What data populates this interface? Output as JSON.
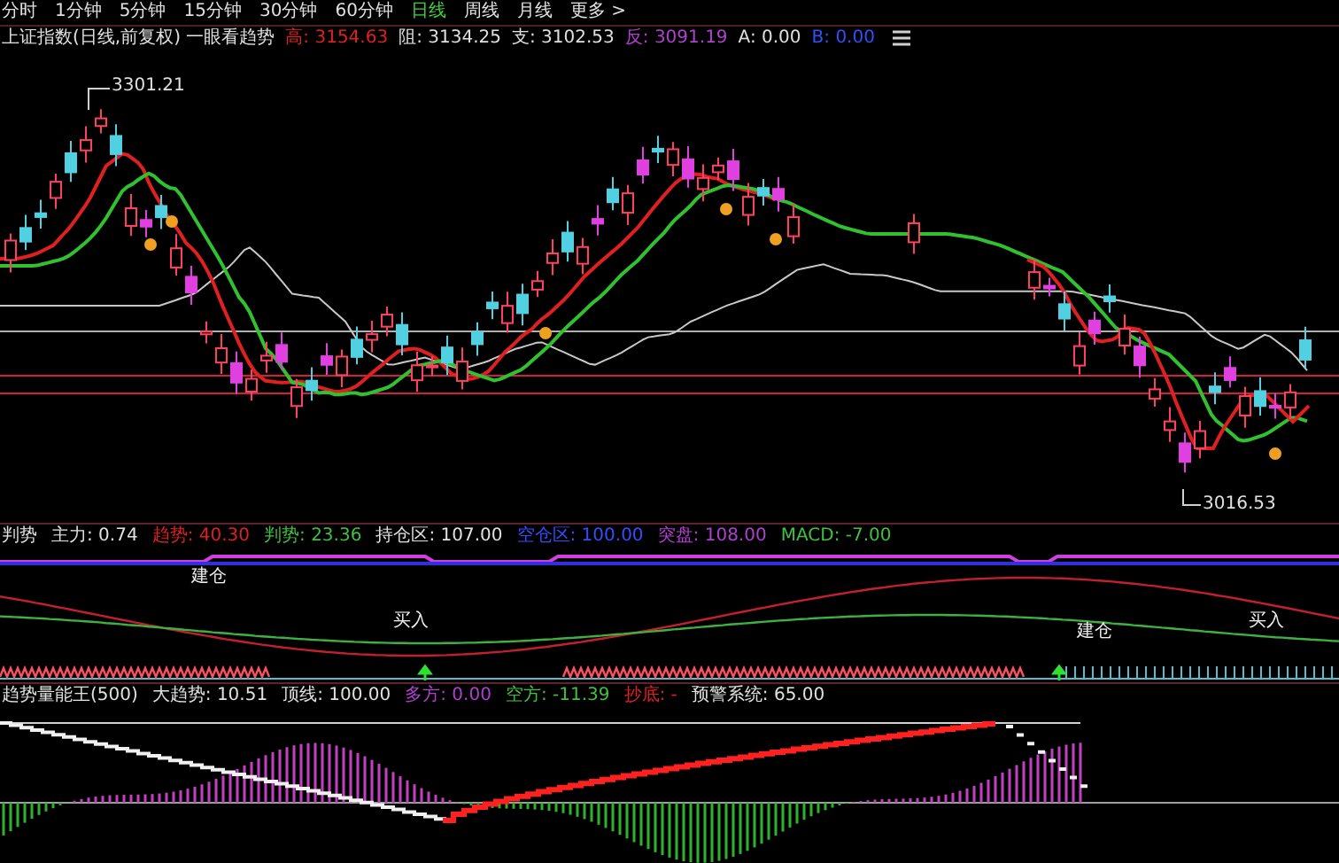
{
  "tabs": [
    {
      "label": "分时",
      "selected": false
    },
    {
      "label": "1分钟",
      "selected": false
    },
    {
      "label": "5分钟",
      "selected": false
    },
    {
      "label": "15分钟",
      "selected": false
    },
    {
      "label": "30分钟",
      "selected": false
    },
    {
      "label": "60分钟",
      "selected": false
    },
    {
      "label": "日线",
      "selected": true
    },
    {
      "label": "周线",
      "selected": false
    },
    {
      "label": "月线",
      "selected": false
    },
    {
      "label": "更多 >",
      "selected": false
    }
  ],
  "info_bar": {
    "title": "上证指数(日线,前复权) 一眼看趋势",
    "values": [
      {
        "text": "高: 3154.63",
        "color": "#e02020"
      },
      {
        "text": "阻: 3134.25",
        "color": "#e0e0e0"
      },
      {
        "text": "支: 3102.53",
        "color": "#e0e0e0"
      },
      {
        "text": "反: 3091.19",
        "color": "#b040d0"
      },
      {
        "text": "A: 0.00",
        "color": "#e0e0e0"
      },
      {
        "text": "B: 0.00",
        "color": "#3050ff"
      }
    ]
  },
  "main_chart": {
    "high_label": "3301.21",
    "low_label": "3016.53"
  },
  "indicator_1": {
    "title": "判势",
    "values": [
      {
        "text": "主力: 0.74",
        "color": "#e0e0e0"
      },
      {
        "text": "趋势: 40.30",
        "color": "#e02020"
      },
      {
        "text": "判势: 23.36",
        "color": "#40c040"
      },
      {
        "text": "持仓区: 107.00",
        "color": "#e0e0e0"
      },
      {
        "text": "空仓区: 100.00",
        "color": "#3050ff"
      },
      {
        "text": "突盘: 108.00",
        "color": "#b040d0"
      },
      {
        "text": "MACD: -7.00",
        "color": "#40c040"
      }
    ],
    "signals": [
      "建仓",
      "买入",
      "建仓",
      "买入"
    ]
  },
  "indicator_2": {
    "title": "趋势量能王(500)",
    "values": [
      {
        "text": "大趋势: 10.51",
        "color": "#e0e0e0"
      },
      {
        "text": "顶线: 100.00",
        "color": "#e0e0e0"
      },
      {
        "text": "多方: 0.00",
        "color": "#b040d0"
      },
      {
        "text": "空方: -11.39",
        "color": "#40c040"
      },
      {
        "text": "抄底: -",
        "color": "#e02020"
      },
      {
        "text": "预警系统: 65.00",
        "color": "#e0e0e0"
      }
    ]
  }
}
